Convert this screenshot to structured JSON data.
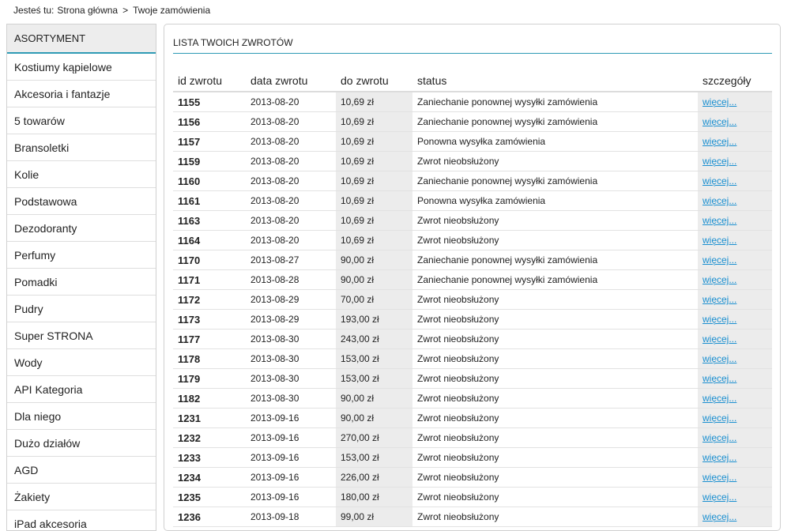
{
  "breadcrumb": {
    "prefix": "Jesteś tu:",
    "home": "Strona główna",
    "separator": ">",
    "current": "Twoje zamówienia"
  },
  "sidebar": {
    "title": "ASORTYMENT",
    "items": [
      "Kostiumy kąpielowe",
      "Akcesoria i fantazje",
      "5 towarów",
      "Bransoletki",
      "Kolie",
      "Podstawowa",
      "Dezodoranty",
      "Perfumy",
      "Pomadki",
      "Pudry",
      "Super STRONA",
      "Wody",
      "API Kategoria",
      "Dla niego",
      "Dużo działów",
      "AGD",
      "Żakiety",
      "iPad akcesoria"
    ]
  },
  "main": {
    "title": "LISTA TWOICH ZWROTÓW",
    "columns": [
      "id zwrotu",
      "data zwrotu",
      "do zwrotu",
      "status",
      "szczegóły"
    ],
    "rows": [
      {
        "id": "1155",
        "date": "2013-08-20",
        "amount": "10,69 zł",
        "status": "Zaniechanie ponownej wysyłki zamówienia",
        "link": "więcej..."
      },
      {
        "id": "1156",
        "date": "2013-08-20",
        "amount": "10,69 zł",
        "status": "Zaniechanie ponownej wysyłki zamówienia",
        "link": "więcej..."
      },
      {
        "id": "1157",
        "date": "2013-08-20",
        "amount": "10,69 zł",
        "status": "Ponowna wysyłka zamówienia",
        "link": "więcej..."
      },
      {
        "id": "1159",
        "date": "2013-08-20",
        "amount": "10,69 zł",
        "status": "Zwrot nieobsłużony",
        "link": "więcej..."
      },
      {
        "id": "1160",
        "date": "2013-08-20",
        "amount": "10,69 zł",
        "status": "Zaniechanie ponownej wysyłki zamówienia",
        "link": "więcej..."
      },
      {
        "id": "1161",
        "date": "2013-08-20",
        "amount": "10,69 zł",
        "status": "Ponowna wysyłka zamówienia",
        "link": "więcej..."
      },
      {
        "id": "1163",
        "date": "2013-08-20",
        "amount": "10,69 zł",
        "status": "Zwrot nieobsłużony",
        "link": "więcej..."
      },
      {
        "id": "1164",
        "date": "2013-08-20",
        "amount": "10,69 zł",
        "status": "Zwrot nieobsłużony",
        "link": "więcej..."
      },
      {
        "id": "1170",
        "date": "2013-08-27",
        "amount": "90,00 zł",
        "status": "Zaniechanie ponownej wysyłki zamówienia",
        "link": "więcej..."
      },
      {
        "id": "1171",
        "date": "2013-08-28",
        "amount": "90,00 zł",
        "status": "Zaniechanie ponownej wysyłki zamówienia",
        "link": "więcej..."
      },
      {
        "id": "1172",
        "date": "2013-08-29",
        "amount": "70,00 zł",
        "status": "Zwrot nieobsłużony",
        "link": "więcej..."
      },
      {
        "id": "1173",
        "date": "2013-08-29",
        "amount": "193,00 zł",
        "status": "Zwrot nieobsłużony",
        "link": "więcej..."
      },
      {
        "id": "1177",
        "date": "2013-08-30",
        "amount": "243,00 zł",
        "status": "Zwrot nieobsłużony",
        "link": "więcej..."
      },
      {
        "id": "1178",
        "date": "2013-08-30",
        "amount": "153,00 zł",
        "status": "Zwrot nieobsłużony",
        "link": "więcej..."
      },
      {
        "id": "1179",
        "date": "2013-08-30",
        "amount": "153,00 zł",
        "status": "Zwrot nieobsłużony",
        "link": "więcej..."
      },
      {
        "id": "1182",
        "date": "2013-08-30",
        "amount": "90,00 zł",
        "status": "Zwrot nieobsłużony",
        "link": "więcej..."
      },
      {
        "id": "1231",
        "date": "2013-09-16",
        "amount": "90,00 zł",
        "status": "Zwrot nieobsłużony",
        "link": "więcej..."
      },
      {
        "id": "1232",
        "date": "2013-09-16",
        "amount": "270,00 zł",
        "status": "Zwrot nieobsłużony",
        "link": "więcej..."
      },
      {
        "id": "1233",
        "date": "2013-09-16",
        "amount": "153,00 zł",
        "status": "Zwrot nieobsłużony",
        "link": "więcej..."
      },
      {
        "id": "1234",
        "date": "2013-09-16",
        "amount": "226,00 zł",
        "status": "Zwrot nieobsłużony",
        "link": "więcej..."
      },
      {
        "id": "1235",
        "date": "2013-09-16",
        "amount": "180,00 zł",
        "status": "Zwrot nieobsłużony",
        "link": "więcej..."
      },
      {
        "id": "1236",
        "date": "2013-09-18",
        "amount": "99,00 zł",
        "status": "Zwrot nieobsłużony",
        "link": "więcej..."
      }
    ]
  },
  "colors": {
    "accent": "#2f9bb5",
    "link": "#1a8fd0",
    "shaded_column": "#ececec"
  }
}
